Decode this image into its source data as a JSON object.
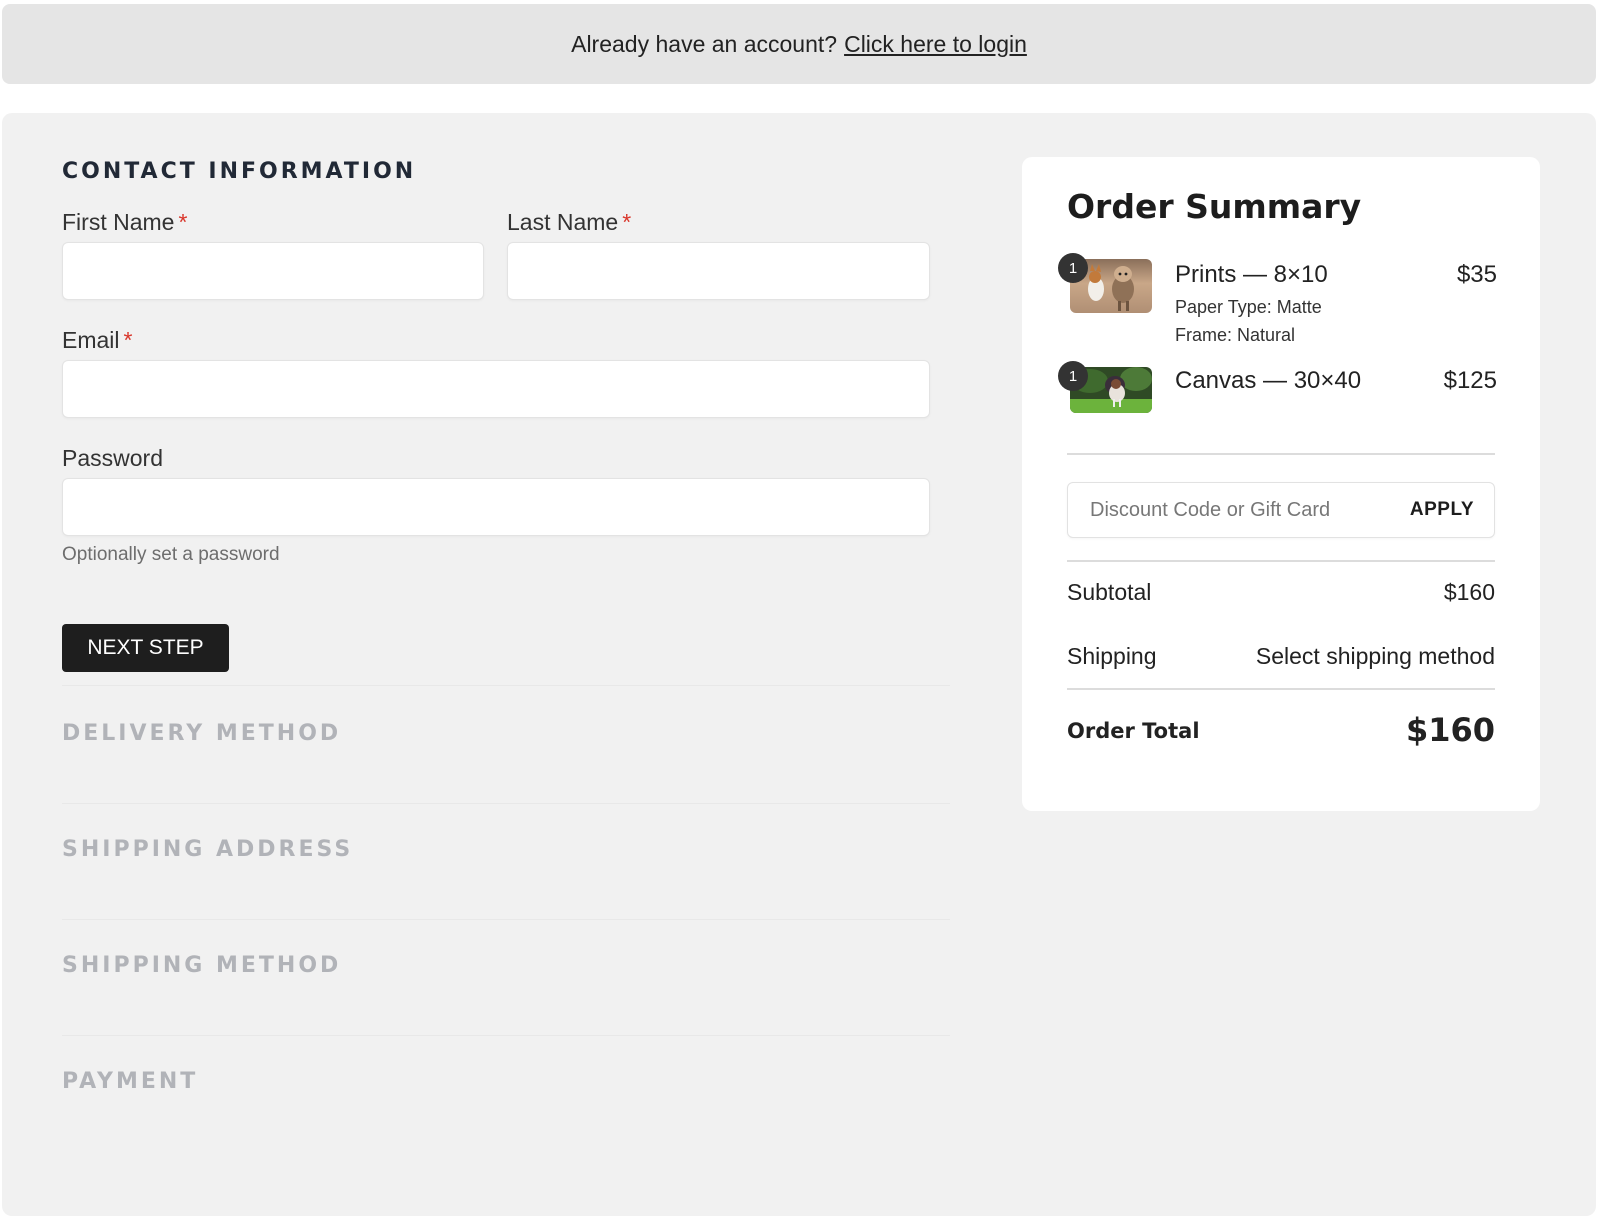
{
  "login_bar": {
    "prompt": "Already have an account?",
    "link": "Click here to login"
  },
  "contact": {
    "title": "CONTACT INFORMATION",
    "first_name": {
      "label": "First Name",
      "required_mark": "*",
      "value": "",
      "placeholder": ""
    },
    "last_name": {
      "label": "Last Name",
      "required_mark": "*",
      "value": "",
      "placeholder": ""
    },
    "email": {
      "label": "Email",
      "required_mark": "*",
      "value": "",
      "placeholder": ""
    },
    "password": {
      "label": "Password",
      "value": "",
      "placeholder": "",
      "hint": "Optionally set a password"
    },
    "next_button": "NEXT STEP"
  },
  "steps": [
    {
      "label": "DELIVERY METHOD"
    },
    {
      "label": "SHIPPING ADDRESS"
    },
    {
      "label": "SHIPPING METHOD"
    },
    {
      "label": "PAYMENT"
    }
  ],
  "summary": {
    "title": "Order Summary",
    "items": [
      {
        "name": "Prints — 8×10",
        "quantity": "1",
        "price": "$35",
        "thumbnail": "photo-of-two-dogs-running",
        "meta": [
          "Paper Type: Matte",
          "Frame: Natural"
        ]
      },
      {
        "name": "Canvas — 30×40",
        "quantity": "1",
        "price": "$125",
        "thumbnail": "photo-of-dog-on-grass",
        "meta": []
      }
    ],
    "discount": {
      "placeholder": "Discount Code or Gift Card",
      "value": "",
      "apply_label": "APPLY"
    },
    "subtotal": {
      "label": "Subtotal",
      "value": "$160"
    },
    "shipping": {
      "label": "Shipping",
      "value": "Select shipping method"
    },
    "total": {
      "label": "Order Total",
      "value": "$160"
    }
  },
  "colors": {
    "required": "#d9362b",
    "primary_button": "#1e1e1e",
    "muted_step": "#b1b3b8",
    "page_panel": "#f1f1f1"
  }
}
